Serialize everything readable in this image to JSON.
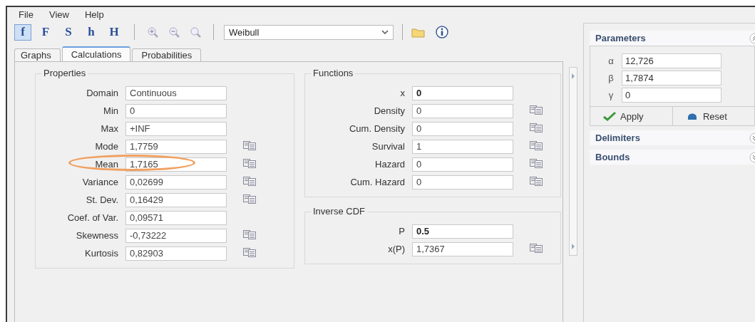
{
  "menu": [
    "File",
    "View",
    "Help"
  ],
  "toolbar": {
    "function_buttons": [
      {
        "label": "f",
        "selected": true
      },
      {
        "label": "F",
        "selected": false
      },
      {
        "label": "S",
        "selected": false
      },
      {
        "label": "h",
        "selected": false
      },
      {
        "label": "H",
        "selected": false
      }
    ],
    "distribution": "Weibull"
  },
  "tabs": [
    {
      "label": "Graphs",
      "selected": false
    },
    {
      "label": "Calculations",
      "selected": true
    },
    {
      "label": "Probabilities",
      "selected": false
    }
  ],
  "properties": {
    "title": "Properties",
    "rows": [
      {
        "label": "Domain",
        "value": "Continuous",
        "kind": "output",
        "copy": false,
        "highlighted": false
      },
      {
        "label": "Min",
        "value": "0",
        "kind": "output",
        "copy": false,
        "highlighted": false
      },
      {
        "label": "Max",
        "value": "+INF",
        "kind": "output",
        "copy": false,
        "highlighted": false
      },
      {
        "label": "Mode",
        "value": "1,7759",
        "kind": "output",
        "copy": true,
        "highlighted": false
      },
      {
        "label": "Mean",
        "value": "1,7165",
        "kind": "output",
        "copy": true,
        "highlighted": true
      },
      {
        "label": "Variance",
        "value": "0,02699",
        "kind": "output",
        "copy": true,
        "highlighted": false
      },
      {
        "label": "St. Dev.",
        "value": "0,16429",
        "kind": "output",
        "copy": true,
        "highlighted": false
      },
      {
        "label": "Coef. of Var.",
        "value": "0,09571",
        "kind": "output",
        "copy": false,
        "highlighted": false
      },
      {
        "label": "Skewness",
        "value": "-0,73222",
        "kind": "output",
        "copy": true,
        "highlighted": false
      },
      {
        "label": "Kurtosis",
        "value": "0,82903",
        "kind": "output",
        "copy": true,
        "highlighted": false
      }
    ]
  },
  "functions": {
    "title": "Functions",
    "rows": [
      {
        "label": "x",
        "value": "0",
        "kind": "input",
        "copy": false
      },
      {
        "label": "Density",
        "value": "0",
        "kind": "output",
        "copy": true
      },
      {
        "label": "Cum. Density",
        "value": "0",
        "kind": "output",
        "copy": true
      },
      {
        "label": "Survival",
        "value": "1",
        "kind": "output",
        "copy": true
      },
      {
        "label": "Hazard",
        "value": "0",
        "kind": "output",
        "copy": true
      },
      {
        "label": "Cum. Hazard",
        "value": "0",
        "kind": "output",
        "copy": true
      }
    ]
  },
  "inverse_cdf": {
    "title": "Inverse CDF",
    "rows": [
      {
        "label": "P",
        "value": "0.5",
        "kind": "input",
        "copy": false
      },
      {
        "label": "x(P)",
        "value": "1,7367",
        "kind": "output",
        "copy": true
      }
    ]
  },
  "parameters": {
    "title": "Parameters",
    "expanded": true,
    "rows": [
      {
        "symbol": "α",
        "value": "12,726"
      },
      {
        "symbol": "β",
        "value": "1,7874"
      },
      {
        "symbol": "γ",
        "value": "0"
      }
    ],
    "apply": "Apply",
    "reset": "Reset"
  },
  "sections": [
    {
      "title": "Delimiters",
      "expanded": false
    },
    {
      "title": "Bounds",
      "expanded": false
    }
  ]
}
